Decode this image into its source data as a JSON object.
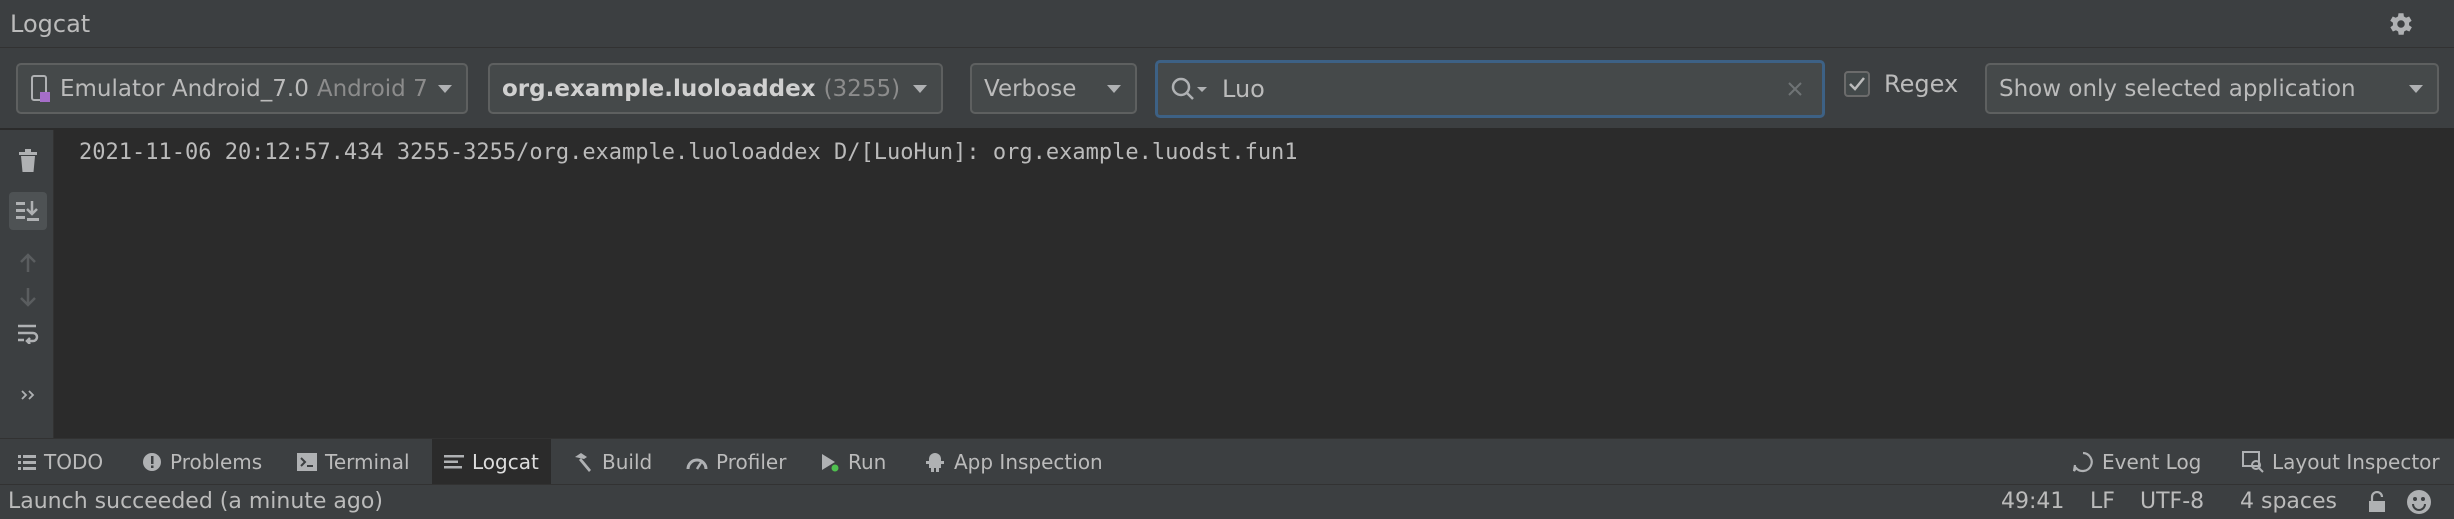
{
  "window": {
    "title": "Logcat"
  },
  "toolbar": {
    "device_name": "Emulator Android_7.0",
    "device_os": "Android 7",
    "package_name": "org.example.luoloaddex",
    "package_pid": "(3255)",
    "log_level": "Verbose",
    "search_value": "Luo",
    "regex_label": "Regex",
    "regex_checked": true,
    "filter_option": "Show only selected application"
  },
  "log": {
    "lines": [
      "2021-11-06 20:12:57.434 3255-3255/org.example.luoloaddex D/[LuoHun]: org.example.luodst.fun1"
    ]
  },
  "tool_windows": {
    "todo": "TODO",
    "problems": "Problems",
    "terminal": "Terminal",
    "logcat": "Logcat",
    "build": "Build",
    "profiler": "Profiler",
    "run": "Run",
    "app_inspection": "App Inspection",
    "event_log": "Event Log",
    "layout_inspector": "Layout Inspector"
  },
  "status": {
    "message": "Launch succeeded (a minute ago)",
    "position": "49:41",
    "line_separator": "LF",
    "encoding": "UTF-8",
    "indent": "4 spaces"
  },
  "colors": {
    "background": "#2b2b2b",
    "panel": "#3c3f41",
    "focus_border": "#3d6185",
    "text": "#bbbbbb"
  },
  "icons": [
    "gear-icon",
    "phone-icon",
    "search-icon",
    "clear-icon",
    "check-icon",
    "trash-icon",
    "scroll-to-end-icon",
    "arrow-up-icon",
    "arrow-down-icon",
    "soft-wrap-icon",
    "more-icon",
    "list-icon",
    "problems-icon",
    "terminal-icon",
    "logcat-icon",
    "hammer-icon",
    "profiler-icon",
    "run-icon",
    "app-inspection-icon",
    "event-log-icon",
    "layout-inspector-icon",
    "lock-icon",
    "smiley-icon"
  ]
}
